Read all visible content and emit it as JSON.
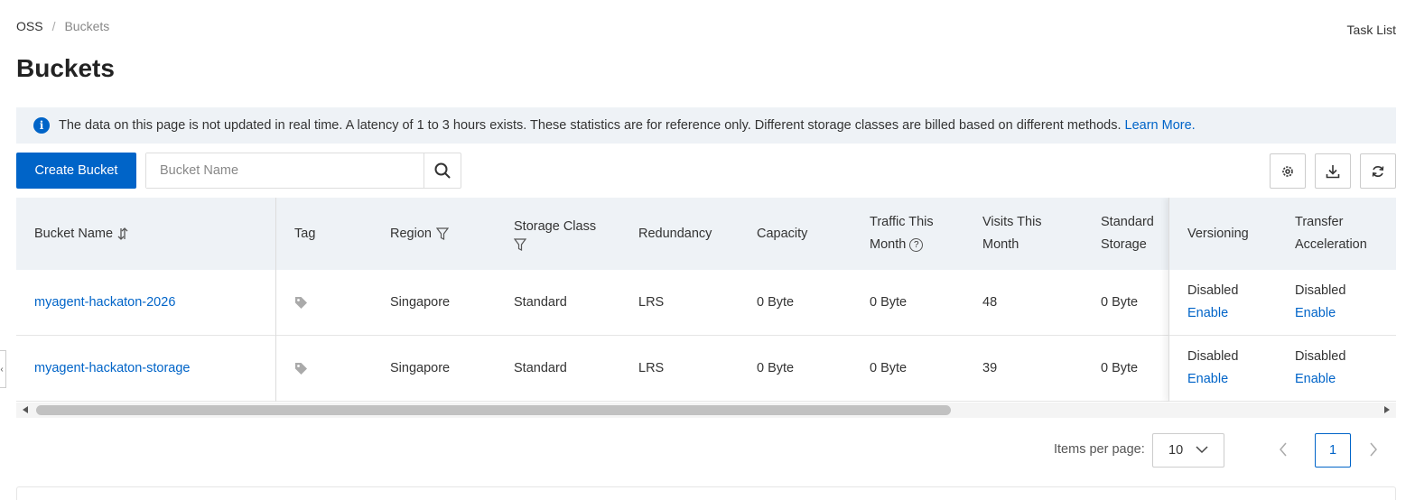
{
  "breadcrumb": {
    "root": "OSS",
    "separator": "/",
    "current": "Buckets"
  },
  "header": {
    "task_list": "Task List",
    "title": "Buckets"
  },
  "notice": {
    "text": "The data on this page is not updated in real time. A latency of 1 to 3 hours exists. These statistics are for reference only. Different storage classes are billed based on different methods.",
    "link": "Learn More."
  },
  "toolbar": {
    "create_label": "Create Bucket",
    "search_placeholder": "Bucket Name"
  },
  "table": {
    "headers": {
      "bucket_name": "Bucket Name",
      "tag": "Tag",
      "region": "Region",
      "storage_class": "Storage Class",
      "redundancy": "Redundancy",
      "capacity": "Capacity",
      "traffic_line1": "Traffic This",
      "traffic_line2": "Month",
      "visits_line1": "Visits This",
      "visits_line2": "Month",
      "standard_line1": "Standard",
      "standard_line2": "Storage",
      "versioning": "Versioning",
      "transfer_line1": "Transfer",
      "transfer_line2": "Acceleration"
    },
    "rows": [
      {
        "name": "myagent-hackaton-2026",
        "region": "Singapore",
        "storage_class": "Standard",
        "redundancy": "LRS",
        "capacity": "0 Byte",
        "traffic": "0 Byte",
        "visits": "48",
        "standard_storage": "0 Byte",
        "versioning": "Disabled",
        "versioning_action": "Enable",
        "transfer": "Disabled",
        "transfer_action": "Enable"
      },
      {
        "name": "myagent-hackaton-storage",
        "region": "Singapore",
        "storage_class": "Standard",
        "redundancy": "LRS",
        "capacity": "0 Byte",
        "traffic": "0 Byte",
        "visits": "39",
        "standard_storage": "0 Byte",
        "versioning": "Disabled",
        "versioning_action": "Enable",
        "transfer": "Disabled",
        "transfer_action": "Enable"
      }
    ]
  },
  "pagination": {
    "items_label": "Items per page:",
    "page_size": "10",
    "current_page": "1"
  },
  "colors": {
    "accent": "#0064c8",
    "header_bg": "#eef2f6"
  }
}
